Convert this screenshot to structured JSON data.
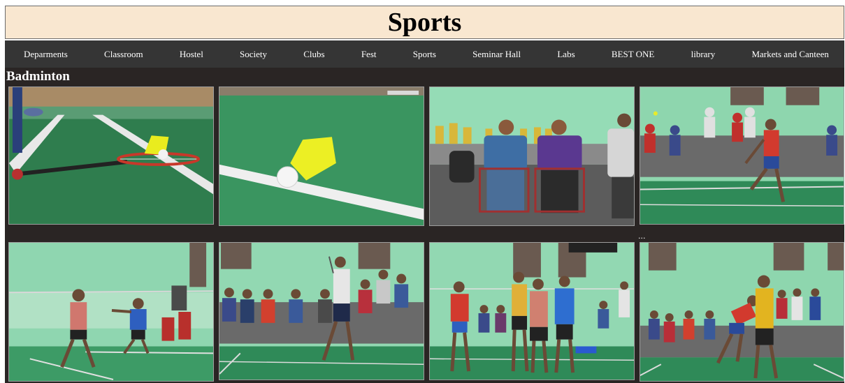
{
  "header": {
    "title": "Sports"
  },
  "nav": {
    "items": [
      "Deparments",
      "Classroom",
      "Hostel",
      "Society",
      "Clubs",
      "Fest",
      "Sports",
      "Seminar Hall",
      "Labs",
      "BEST ONE",
      "library",
      "Markets and Canteen"
    ]
  },
  "section": {
    "title": "Badminton"
  },
  "gallery": {
    "photos": [
      "shuttlecock-racket-photo",
      "shuttlecock-line-photo",
      "spectators-trophies-photo",
      "player-smash-photo",
      "doubles-match-photo",
      "player-walking-photo",
      "players-standing-photo",
      "player-leaping-photo"
    ],
    "ellipsis": "..."
  },
  "colors": {
    "header_bg": "#f9e7d0",
    "nav_bg": "#353535",
    "content_bg": "#2a2524",
    "court_green": "#3f9e6a",
    "wall_mint": "#8fd6b0"
  }
}
